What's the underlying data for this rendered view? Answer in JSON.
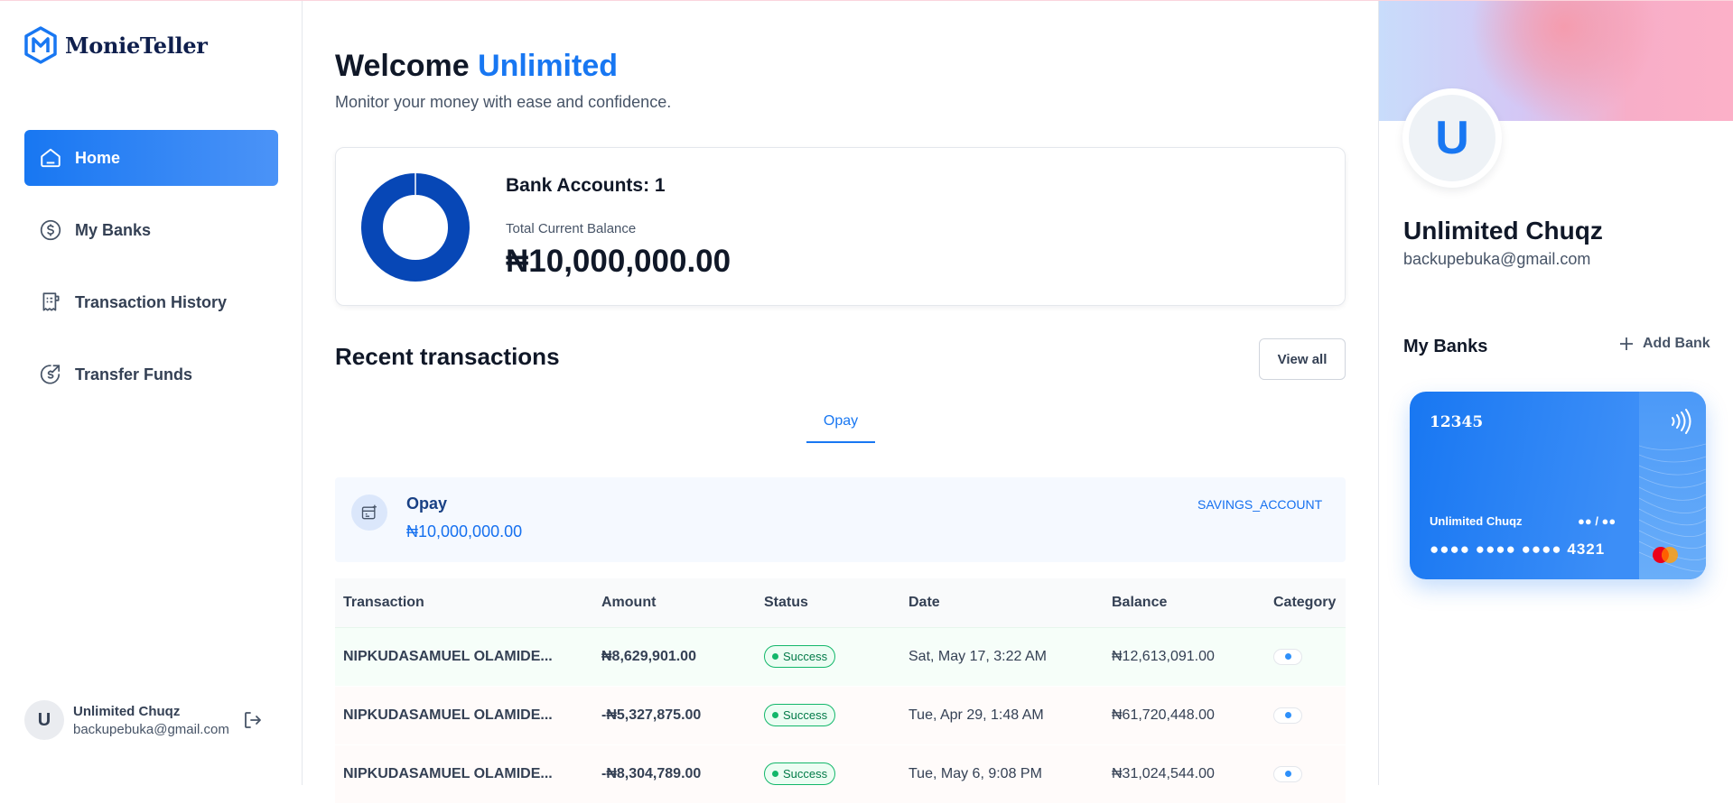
{
  "brand": {
    "name_part1": "Monie",
    "name_part2": "Teller"
  },
  "nav": [
    {
      "label": "Home",
      "icon": "home-icon",
      "active": true
    },
    {
      "label": "My Banks",
      "icon": "dollar-circle-icon",
      "active": false
    },
    {
      "label": "Transaction History",
      "icon": "receipt-icon",
      "active": false
    },
    {
      "label": "Transfer Funds",
      "icon": "money-send-icon",
      "active": false
    }
  ],
  "sidebar_footer": {
    "initial": "U",
    "name": "Unlimited Chuqz",
    "email": "backupebuka@gmail.com"
  },
  "header": {
    "welcome": "Welcome",
    "user_first": "Unlimited",
    "subtitle": "Monitor your money with ease and confidence."
  },
  "balance": {
    "bank_accounts_label": "Bank Accounts: 1",
    "total_label": "Total Current Balance",
    "total_value": "₦10,000,000.00",
    "donut_color": "#0747b6"
  },
  "recent": {
    "title": "Recent transactions",
    "view_all": "View all",
    "tab": "Opay"
  },
  "bank_info": {
    "name": "Opay",
    "balance": "₦10,000,000.00",
    "type": "SAVINGS_ACCOUNT"
  },
  "table": {
    "headers": [
      "Transaction",
      "Amount",
      "Status",
      "Date",
      "Balance",
      "Category"
    ],
    "rows": [
      {
        "name": "NIPKUDASAMUEL OLAMIDE...",
        "amount": "₦8,629,901.00",
        "kind": "credit",
        "status": "Success",
        "date": "Sat, May 17, 3:22 AM",
        "balance": "₦12,613,091.00"
      },
      {
        "name": "NIPKUDASAMUEL OLAMIDE...",
        "amount": "-₦5,327,875.00",
        "kind": "debit",
        "status": "Success",
        "date": "Tue, Apr 29, 1:48 AM",
        "balance": "₦61,720,448.00"
      },
      {
        "name": "NIPKUDASAMUEL OLAMIDE...",
        "amount": "-₦8,304,789.00",
        "kind": "debit",
        "status": "Success",
        "date": "Tue, May 6, 9:08 PM",
        "balance": "₦31,024,544.00"
      }
    ]
  },
  "profile": {
    "initial": "U",
    "name": "Unlimited Chuqz",
    "email": "backupebuka@gmail.com"
  },
  "my_banks": {
    "title": "My Banks",
    "add_label": "Add Bank",
    "card": {
      "title": "12345",
      "holder": "Unlimited Chuqz",
      "expiry": "●● / ●●",
      "number": "●●●● ●●●● ●●●● 4321"
    }
  },
  "colors": {
    "primary": "#1877f2",
    "success": "#12b76a",
    "danger": "#f04438"
  }
}
